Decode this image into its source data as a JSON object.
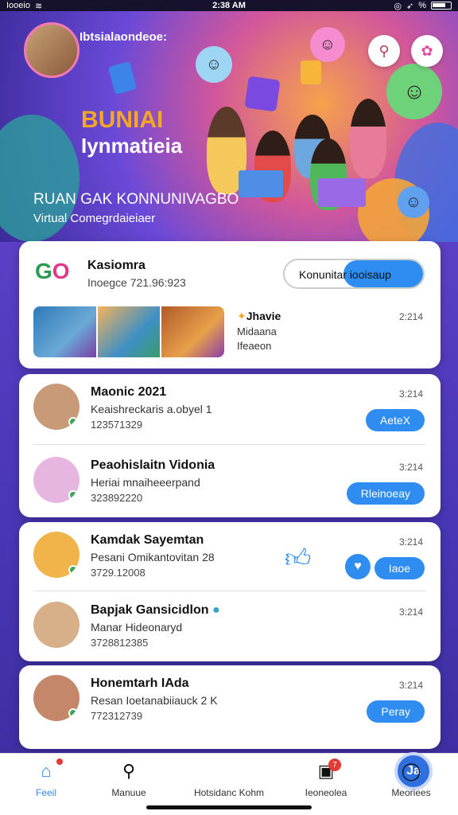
{
  "status_bar": {
    "left": "Iooeio",
    "time": "2:38 AM",
    "right": "%"
  },
  "hero": {
    "app_name": "Ibtsialaondeoe:",
    "title_line1": "BUNIAI",
    "title_line2": "Iynmatieia",
    "heading": "RUAN GAK KONNUNIVAGBO",
    "subheading": "Virtual Comegrdaieiaer"
  },
  "featured_card": {
    "logo_text": "GO",
    "name": "Kasiomra",
    "meta": "Inoegce 721.96:923",
    "toggle_label": "Konunitar iooisaup",
    "time": "2:214",
    "post_sender": "Jhavie",
    "post_line2": "Midaana",
    "post_line3": "Ifeaeon"
  },
  "contacts": [
    {
      "name": "Maonic 2021",
      "line2": "Keaishreckaris a.obyel 1",
      "line3": "123571329",
      "time": "3:214",
      "button": "AeteX"
    },
    {
      "name": "Peaohislaitn Vidonia",
      "line2": "Heriai mnaiheeerpand",
      "line3": "323892220",
      "time": "3:214",
      "button": "Rleinoeay"
    },
    {
      "name": "Kamdak Sayemtan",
      "line2": "Pesani Omikantovitan 28",
      "line3": "3729.12008",
      "time": "3:214",
      "button": "Iaoe"
    },
    {
      "name": "Bapjak Gansicidlon",
      "line2": "Manar Hideonaryd",
      "line3": "3728812385",
      "time": "3:214",
      "button": ""
    },
    {
      "name": "Honemtarh IAda",
      "line2": "Resan Ioetanabiiauck 2 K",
      "line3": "772312739",
      "time": "3:214",
      "button": "Peray"
    }
  ],
  "bottom_nav": {
    "items": [
      {
        "label": "Feeil"
      },
      {
        "label": "Manuue"
      },
      {
        "label": "Hotsidanc Kohm",
        "fab_text": "Ja"
      },
      {
        "label": "Ieoneolea",
        "badge": "7"
      },
      {
        "label": "Meoriees"
      }
    ],
    "home_badge": ""
  },
  "colors": {
    "accent": "#2f8cf0",
    "background": "#4a37b8"
  }
}
